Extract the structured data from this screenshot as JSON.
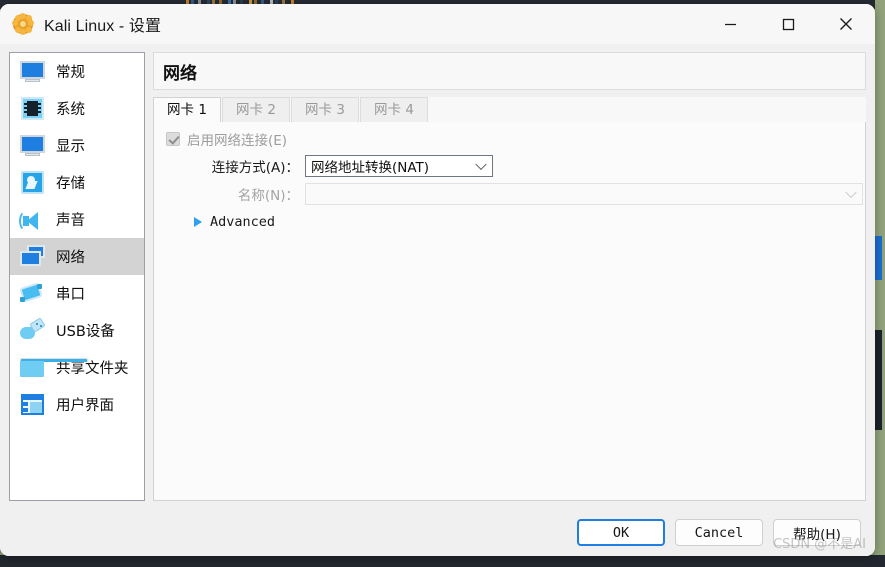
{
  "window": {
    "title": "Kali Linux - 设置",
    "app_icon": "virtualbox-gear-icon",
    "minimize_label": "—",
    "maximize_label": "□",
    "close_label": "✕"
  },
  "sidebar": {
    "items": [
      {
        "label": "常规",
        "icon": "monitor-icon",
        "selected": false
      },
      {
        "label": "系统",
        "icon": "chip-icon",
        "selected": false
      },
      {
        "label": "显示",
        "icon": "display-icon",
        "selected": false
      },
      {
        "label": "存储",
        "icon": "harddisk-icon",
        "selected": false
      },
      {
        "label": "声音",
        "icon": "speaker-icon",
        "selected": false
      },
      {
        "label": "网络",
        "icon": "network-icon",
        "selected": true
      },
      {
        "label": "串口",
        "icon": "serial-port-icon",
        "selected": false
      },
      {
        "label": "USB设备",
        "icon": "usb-icon",
        "selected": false
      },
      {
        "label": "共享文件夹",
        "icon": "folder-icon",
        "selected": false
      },
      {
        "label": "用户界面",
        "icon": "ui-window-icon",
        "selected": false
      }
    ]
  },
  "page": {
    "title": "网络",
    "tabs": [
      {
        "label": "网卡 1",
        "active": true
      },
      {
        "label": "网卡 2",
        "active": false
      },
      {
        "label": "网卡 3",
        "active": false
      },
      {
        "label": "网卡 4",
        "active": false
      }
    ],
    "enable_adapter": {
      "label": "启用网络连接(E)",
      "checked": true,
      "disabled": true
    },
    "attached_to": {
      "label": "连接方式(A)：",
      "value": "网络地址转换(NAT)"
    },
    "name": {
      "label": "名称(N)：",
      "value": "",
      "disabled": true
    },
    "advanced": {
      "label": "Advanced",
      "expanded": false,
      "icon": "chevron-right-triangle-icon"
    }
  },
  "footer": {
    "ok_label": "OK",
    "cancel_label": "Cancel",
    "help_label": "帮助(H)"
  },
  "watermark": "CSDN @不是AI"
}
